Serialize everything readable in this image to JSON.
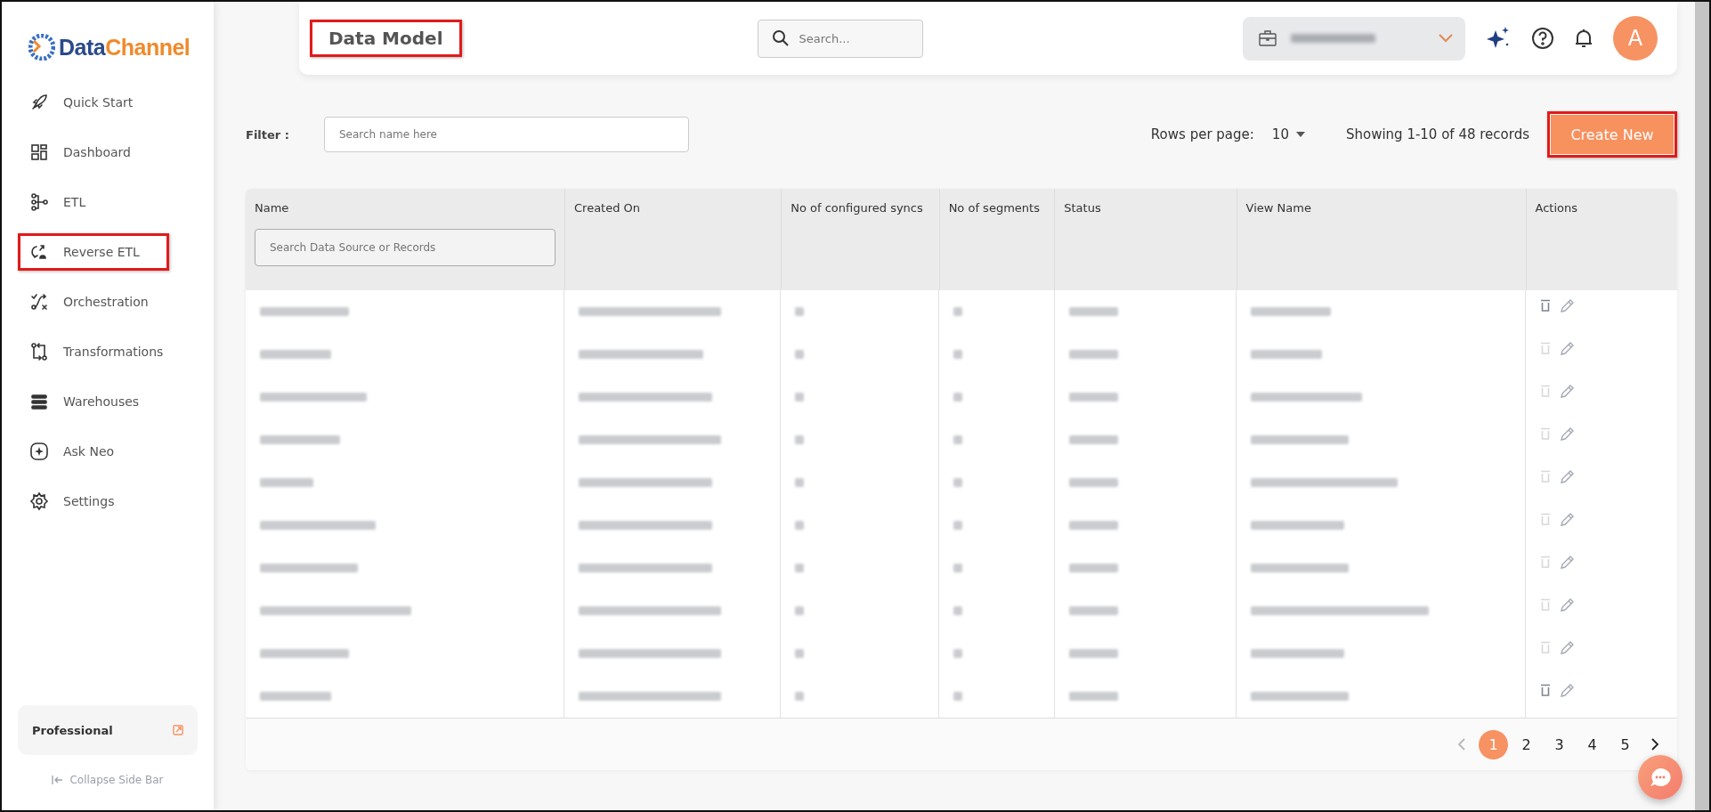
{
  "sidebar": {
    "logo": [
      "Data",
      "Channel"
    ],
    "items": [
      {
        "label": "Quick Start",
        "highlighted": false
      },
      {
        "label": "Dashboard",
        "highlighted": false
      },
      {
        "label": "ETL",
        "highlighted": false
      },
      {
        "label": "Reverse ETL",
        "highlighted": true
      },
      {
        "label": "Orchestration",
        "highlighted": false
      },
      {
        "label": "Transformations",
        "highlighted": false
      },
      {
        "label": "Warehouses",
        "highlighted": false
      },
      {
        "label": "Ask Neo",
        "highlighted": false
      },
      {
        "label": "Settings",
        "highlighted": false
      }
    ],
    "plan": {
      "label": "Professional"
    },
    "collapse": {
      "label": "Collapse Side Bar"
    }
  },
  "header": {
    "title": "Data Model",
    "title_highlighted": true,
    "search": {
      "placeholder": "Search..."
    },
    "avatar": "A"
  },
  "toolbar": {
    "filter_label": "Filter :",
    "filter": {
      "placeholder": "Search name here"
    },
    "rows_label": "Rows per page:",
    "rows_value": "10",
    "showing": "Showing 1-10 of 48 records",
    "create": {
      "label": "Create New",
      "highlighted": true
    }
  },
  "table": {
    "columns": [
      "Name",
      "Created On",
      "No of configured syncs",
      "No of segments",
      "Status",
      "View Name",
      "Actions"
    ],
    "name_search": {
      "placeholder": "Search Data Source or Records"
    },
    "rows": [
      {
        "delete_enabled": true
      },
      {
        "delete_enabled": false
      },
      {
        "delete_enabled": false
      },
      {
        "delete_enabled": false
      },
      {
        "delete_enabled": false
      },
      {
        "delete_enabled": false
      },
      {
        "delete_enabled": false
      },
      {
        "delete_enabled": false
      },
      {
        "delete_enabled": false
      },
      {
        "delete_enabled": true
      }
    ]
  },
  "pagination": {
    "prev_disabled": true,
    "pages": [
      {
        "label": "1",
        "selected": true
      },
      {
        "label": "2",
        "selected": false
      },
      {
        "label": "3",
        "selected": false
      },
      {
        "label": "4",
        "selected": false
      },
      {
        "label": "5",
        "selected": false
      }
    ]
  }
}
